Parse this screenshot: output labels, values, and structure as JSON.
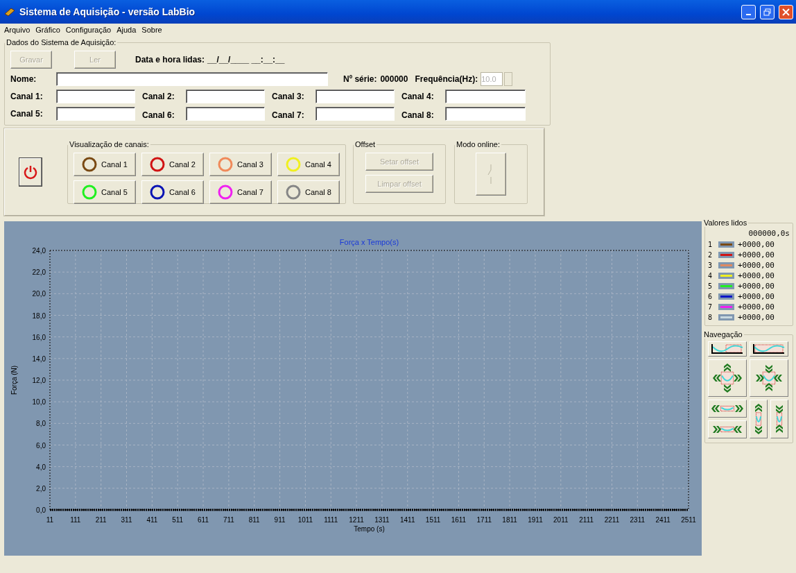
{
  "window": {
    "title": "Sistema de Aquisição - versão LabBio"
  },
  "menu": [
    "Arquivo",
    "Gráfico",
    "Configuração",
    "Ajuda",
    "Sobre"
  ],
  "acquisition": {
    "title": "Dados do Sistema de Aquisição:",
    "buttons": [
      {
        "label": "Gravar",
        "disabled": true
      },
      {
        "label": "Ler",
        "disabled": true
      }
    ],
    "datetime_label": "Data e hora lidas:",
    "datetime_value": "__/__/____ __:__:__",
    "name_label": "Nome:",
    "serial_label": "Nº série:",
    "serial_value": "000000",
    "frequency_label": "Frequência(Hz):",
    "frequency": {
      "value": "10.0",
      "disabled": true
    },
    "channel_fields": [
      {
        "label": "Canal 1:"
      },
      {
        "label": "Canal 2:"
      },
      {
        "label": "Canal 3:"
      },
      {
        "label": "Canal 4:"
      },
      {
        "label": "Canal 5:"
      },
      {
        "label": "Canal 6:"
      },
      {
        "label": "Canal 7:"
      },
      {
        "label": "Canal 8:"
      }
    ]
  },
  "channel_view": {
    "title": "Visualização de canais:",
    "channels": [
      {
        "label": "Canal 1",
        "color": "#7a4a14"
      },
      {
        "label": "Canal 2",
        "color": "#d01414"
      },
      {
        "label": "Canal 3",
        "color": "#f08a5a"
      },
      {
        "label": "Canal 4",
        "color": "#f0f020"
      },
      {
        "label": "Canal 5",
        "color": "#20f020"
      },
      {
        "label": "Canal 6",
        "color": "#0a14b4"
      },
      {
        "label": "Canal 7",
        "color": "#f020f0"
      },
      {
        "label": "Canal 8",
        "color": "#868686"
      }
    ]
  },
  "offset": {
    "title": "Offset",
    "buttons": [
      {
        "label": "Setar offset",
        "disabled": true
      },
      {
        "label": "Limpar offset",
        "disabled": true
      }
    ]
  },
  "online": {
    "title": "Modo online:",
    "disabled": true
  },
  "chart": {
    "chart_data": {
      "type": "line",
      "grid": true,
      "title": "Força x Tempo(s)",
      "xlabel": "Tempo (s)",
      "ylabel": "Força (N)",
      "xlim": [
        11,
        2511
      ],
      "ylim": [
        0,
        24
      ],
      "xticks": [
        11,
        111,
        211,
        311,
        411,
        511,
        611,
        711,
        811,
        911,
        1011,
        1111,
        1211,
        1311,
        1411,
        1511,
        1611,
        1711,
        1811,
        1911,
        2011,
        2111,
        2211,
        2311,
        2411,
        2511
      ],
      "yticks": [
        {
          "value": 0,
          "label": "0,0"
        },
        {
          "value": 2,
          "label": "2,0"
        },
        {
          "value": 4,
          "label": "4,0"
        },
        {
          "value": 6,
          "label": "6,0"
        },
        {
          "value": 8,
          "label": "8,0"
        },
        {
          "value": 10,
          "label": "10,0"
        },
        {
          "value": 12,
          "label": "12,0"
        },
        {
          "value": 14,
          "label": "14,0"
        },
        {
          "value": 16,
          "label": "16,0"
        },
        {
          "value": 18,
          "label": "18,0"
        },
        {
          "value": 20,
          "label": "20,0"
        },
        {
          "value": 22,
          "label": "22,0"
        },
        {
          "value": 24,
          "label": "24,0"
        }
      ]
    }
  },
  "readings": {
    "title": "Valores lidos",
    "time": "000000,0s",
    "rows": [
      {
        "index": "1",
        "color": "#7a4a14",
        "value": "+0000,00"
      },
      {
        "index": "2",
        "color": "#d01414",
        "value": "+0000,00"
      },
      {
        "index": "3",
        "color": "#e08a60",
        "value": "+0000,00"
      },
      {
        "index": "4",
        "color": "#f0f020",
        "value": "+0000,00"
      },
      {
        "index": "5",
        "color": "#20f020",
        "value": "+0000,00"
      },
      {
        "index": "6",
        "color": "#0a14c8",
        "value": "+0000,00"
      },
      {
        "index": "7",
        "color": "#f020f0",
        "value": "+0000,00"
      },
      {
        "index": "8",
        "color": "#c8d8e0",
        "value": "+0000,00"
      }
    ]
  },
  "navigation": {
    "title": "Navegação"
  }
}
